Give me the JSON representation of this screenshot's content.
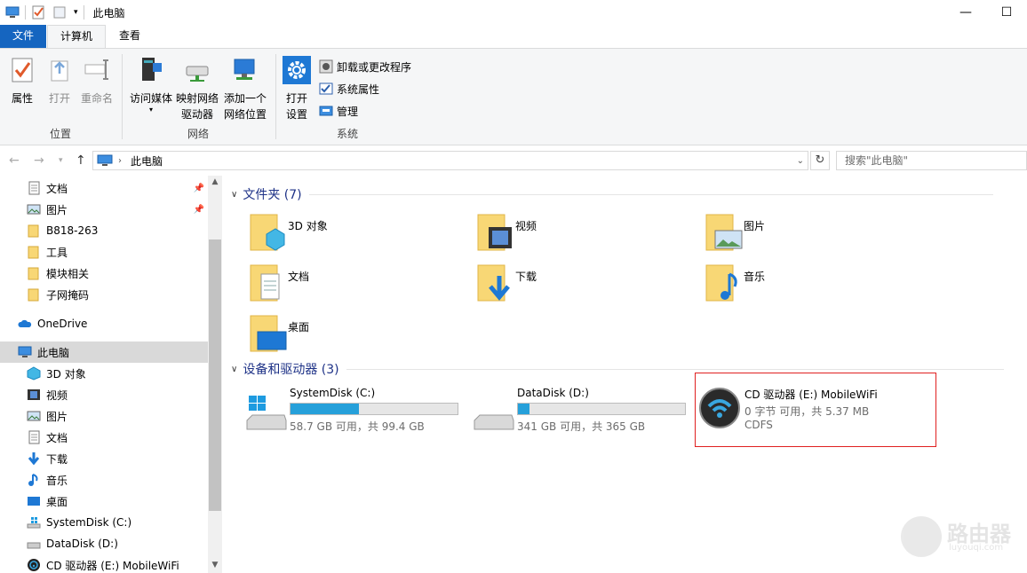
{
  "window": {
    "title": "此电脑",
    "minimize": "—",
    "maximize": "☐"
  },
  "tabs": {
    "file": "文件",
    "computer": "计算机",
    "view": "查看"
  },
  "ribbon": {
    "location": {
      "label": "位置",
      "properties": "属性",
      "open": "打开",
      "rename": "重命名"
    },
    "network": {
      "label": "网络",
      "access_media": "访问媒体",
      "map_drive_line1": "映射网络",
      "map_drive_line2": "驱动器",
      "add_location_line1": "添加一个",
      "add_location_line2": "网络位置"
    },
    "system": {
      "label": "系统",
      "open_settings_line1": "打开",
      "open_settings_line2": "设置",
      "uninstall": "卸载或更改程序",
      "system_properties": "系统属性",
      "manage": "管理"
    }
  },
  "address": {
    "path": "此电脑",
    "search_placeholder": "搜索\"此电脑\""
  },
  "nav": {
    "quick": [
      "文档",
      "图片",
      "B818-263",
      "工具",
      "模块相关",
      "子网掩码"
    ],
    "onedrive": "OneDrive",
    "this_pc": "此电脑",
    "pc_items": [
      "3D 对象",
      "视频",
      "图片",
      "文档",
      "下载",
      "音乐",
      "桌面",
      "SystemDisk (C:)",
      "DataDisk (D:)",
      "CD 驱动器 (E:) MobileWiFi"
    ]
  },
  "content": {
    "folders_header": "文件夹 (7)",
    "folders": [
      "3D 对象",
      "视频",
      "图片",
      "文档",
      "下载",
      "音乐",
      "桌面"
    ],
    "drives_header": "设备和驱动器 (3)",
    "drives": [
      {
        "name": "SystemDisk (C:)",
        "size": "58.7 GB 可用，共 99.4 GB",
        "used_fraction": 0.41
      },
      {
        "name": "DataDisk (D:)",
        "size": "341 GB 可用，共 365 GB",
        "used_fraction": 0.07
      },
      {
        "name": "CD 驱动器 (E:) MobileWiFi",
        "size": "0 字节 可用，共 5.37 MB",
        "fs": "CDFS"
      }
    ]
  },
  "watermark": {
    "text": "路由器",
    "sub": "luyouqi.com"
  },
  "colors": {
    "accent": "#1565c0",
    "folder": "#f8d775",
    "drive_bar": "#26a0da",
    "highlight_border": "#e02020"
  }
}
